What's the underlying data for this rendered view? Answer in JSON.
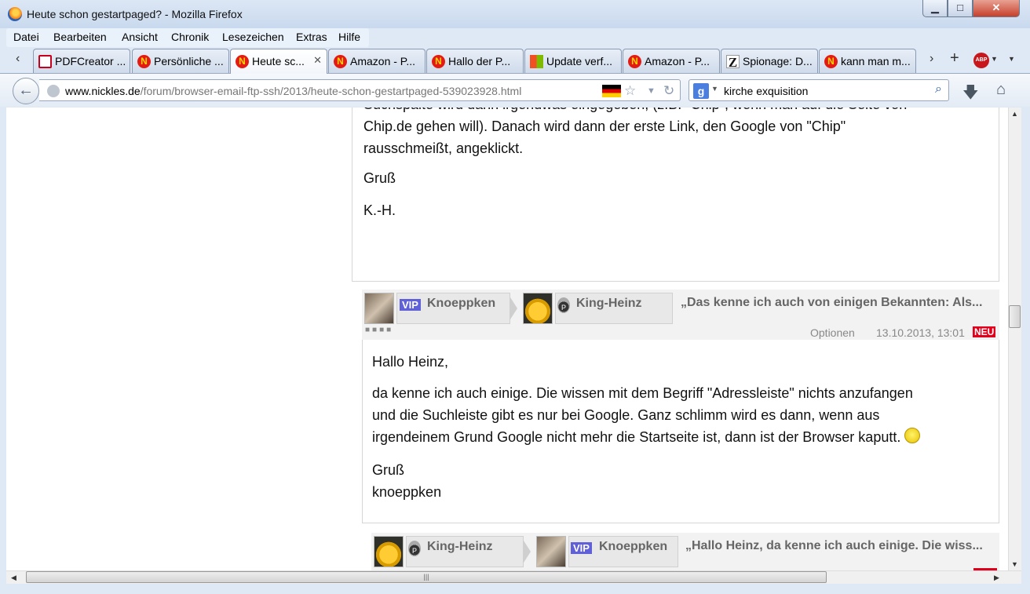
{
  "window": {
    "title": "Heute schon gestartpaged? - Mozilla Firefox",
    "minimize": "▁",
    "maximize": "□",
    "close": "✕"
  },
  "menu": [
    "Datei",
    "Bearbeiten",
    "Ansicht",
    "Chronik",
    "Lesezeichen",
    "Extras",
    "Hilfe"
  ],
  "tabs": [
    {
      "label": "PDFCreator ...",
      "icon": "pdfcreator-icon"
    },
    {
      "label": "Persönliche ...",
      "icon": "nickles-icon"
    },
    {
      "label": "Heute sc...",
      "icon": "nickles-icon",
      "active": true
    },
    {
      "label": "Amazon - P...",
      "icon": "nickles-icon"
    },
    {
      "label": "Hallo der P...",
      "icon": "nickles-icon"
    },
    {
      "label": "Update verf...",
      "icon": "microsoft-icon"
    },
    {
      "label": "Amazon - P...",
      "icon": "nickles-icon"
    },
    {
      "label": "Spionage: D...",
      "icon": "zeit-icon"
    },
    {
      "label": "kann man m...",
      "icon": "nickles-icon"
    }
  ],
  "tab_close": "✕",
  "tab_icon_letter": "N",
  "tab_z_letter": "Z",
  "nav": {
    "url_host": "www.nickles.de",
    "url_path": "/forum/browser-email-ftp-ssh/2013/heute-schon-gestartpaged-539023928.html",
    "search_engine": "g",
    "search_value": "kirche exquisition"
  },
  "post1": {
    "lines": [
      "Suchspalte wird dann irgendwas eingegeben, (z.B. \"Chip\", wenn man auf die Seite von",
      "Chip.de gehen will). Danach wird dann der erste Link, den Google von \"Chip\"",
      "rausschmeißt, angeklickt."
    ],
    "greeting": "Gruß",
    "signature": "K.-H."
  },
  "post2": {
    "author": "Knoeppken",
    "author_badge": "VIP",
    "recipient": "King-Heinz",
    "recipient_badge": "P",
    "subject": "„Das kenne ich auch von einigen Bekannten: Als...",
    "options": "Optionen",
    "date": "13.10.2013, 13:01",
    "new_badge": "NEU",
    "rank_dots": "■■■■",
    "salutation": "Hallo Heinz,",
    "lines": [
      "da kenne ich auch einige. Die wissen mit dem Begriff \"Adressleiste\" nichts anzufangen",
      "und die Suchleiste gibt es nur bei Google. Ganz schlimm wird es dann, wenn aus",
      "irgendeinem Grund Google nicht mehr die Startseite ist, dann ist der Browser kaputt."
    ],
    "greeting": "Gruß",
    "signature": "knoeppken"
  },
  "post3": {
    "author": "King-Heinz",
    "author_badge": "P",
    "recipient": "Knoeppken",
    "recipient_badge": "VIP",
    "subject": "„Hallo Heinz, da kenne ich auch einige. Die wiss..."
  }
}
